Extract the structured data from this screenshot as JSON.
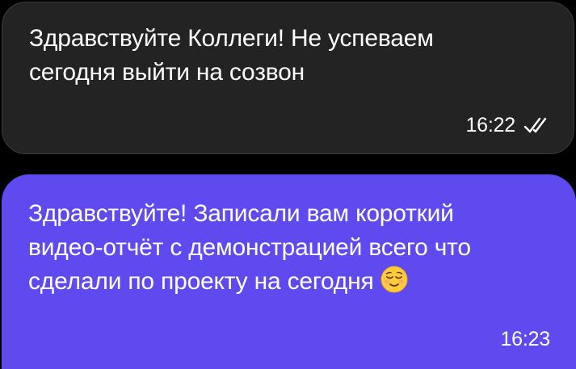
{
  "messages": [
    {
      "direction": "incoming",
      "text": "Здравствуйте Коллеги!  Не успеваем\nсегодня выйти на созвон",
      "time": "16:22",
      "status_icon": "double-check-icon"
    },
    {
      "direction": "outgoing",
      "text": "Здравствуйте! Записали вам короткий\nвидео-отчёт с демонстрацией всего что\nсделали по проекту на сегодня",
      "emoji": "relieved-face-emoji",
      "time": "16:23"
    }
  ],
  "colors": {
    "background": "#000000",
    "incoming_bubble": "#232323",
    "outgoing_bubble": "#5f4af0",
    "text": "#ffffff"
  }
}
